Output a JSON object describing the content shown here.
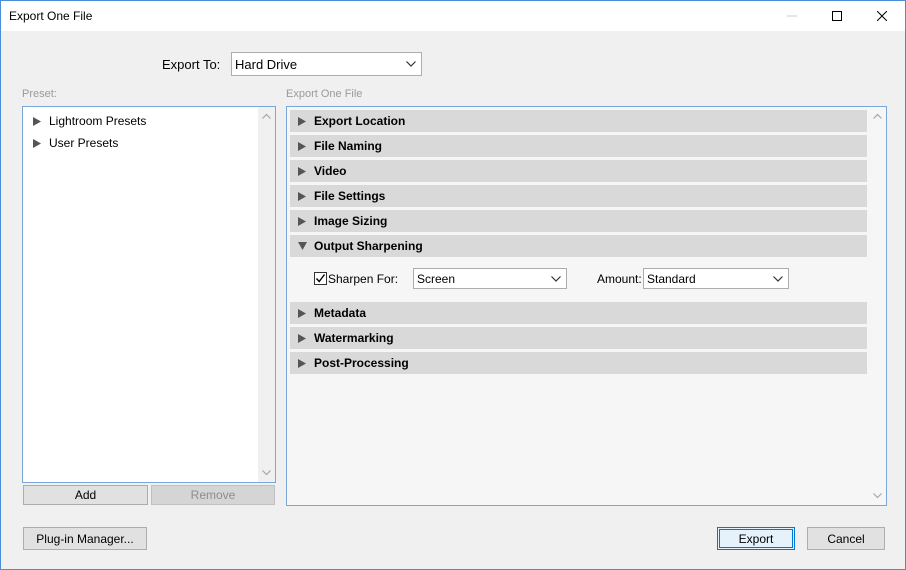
{
  "window": {
    "title": "Export One File"
  },
  "export_to": {
    "label": "Export To:",
    "value": "Hard Drive"
  },
  "preset": {
    "label": "Preset:",
    "items": [
      {
        "label": "Lightroom Presets"
      },
      {
        "label": "User Presets"
      }
    ],
    "add_label": "Add",
    "remove_label": "Remove"
  },
  "export_panel": {
    "label": "Export One File",
    "sections": [
      {
        "label": "Export Location",
        "expanded": false
      },
      {
        "label": "File Naming",
        "expanded": false
      },
      {
        "label": "Video",
        "expanded": false
      },
      {
        "label": "File Settings",
        "expanded": false
      },
      {
        "label": "Image Sizing",
        "expanded": false
      },
      {
        "label": "Output Sharpening",
        "expanded": true
      },
      {
        "label": "Metadata",
        "expanded": false
      },
      {
        "label": "Watermarking",
        "expanded": false
      },
      {
        "label": "Post-Processing",
        "expanded": false
      }
    ],
    "sharpening": {
      "checkbox_label": "Sharpen For:",
      "checked": true,
      "sharpen_for": "Screen",
      "amount_label": "Amount:",
      "amount": "Standard"
    }
  },
  "footer": {
    "plugin_label": "Plug-in Manager...",
    "export_label": "Export",
    "cancel_label": "Cancel"
  },
  "colors": {
    "accent": "#0078d7",
    "section_header": "#d9d9d9",
    "panel_border": "#7aa7d8"
  }
}
